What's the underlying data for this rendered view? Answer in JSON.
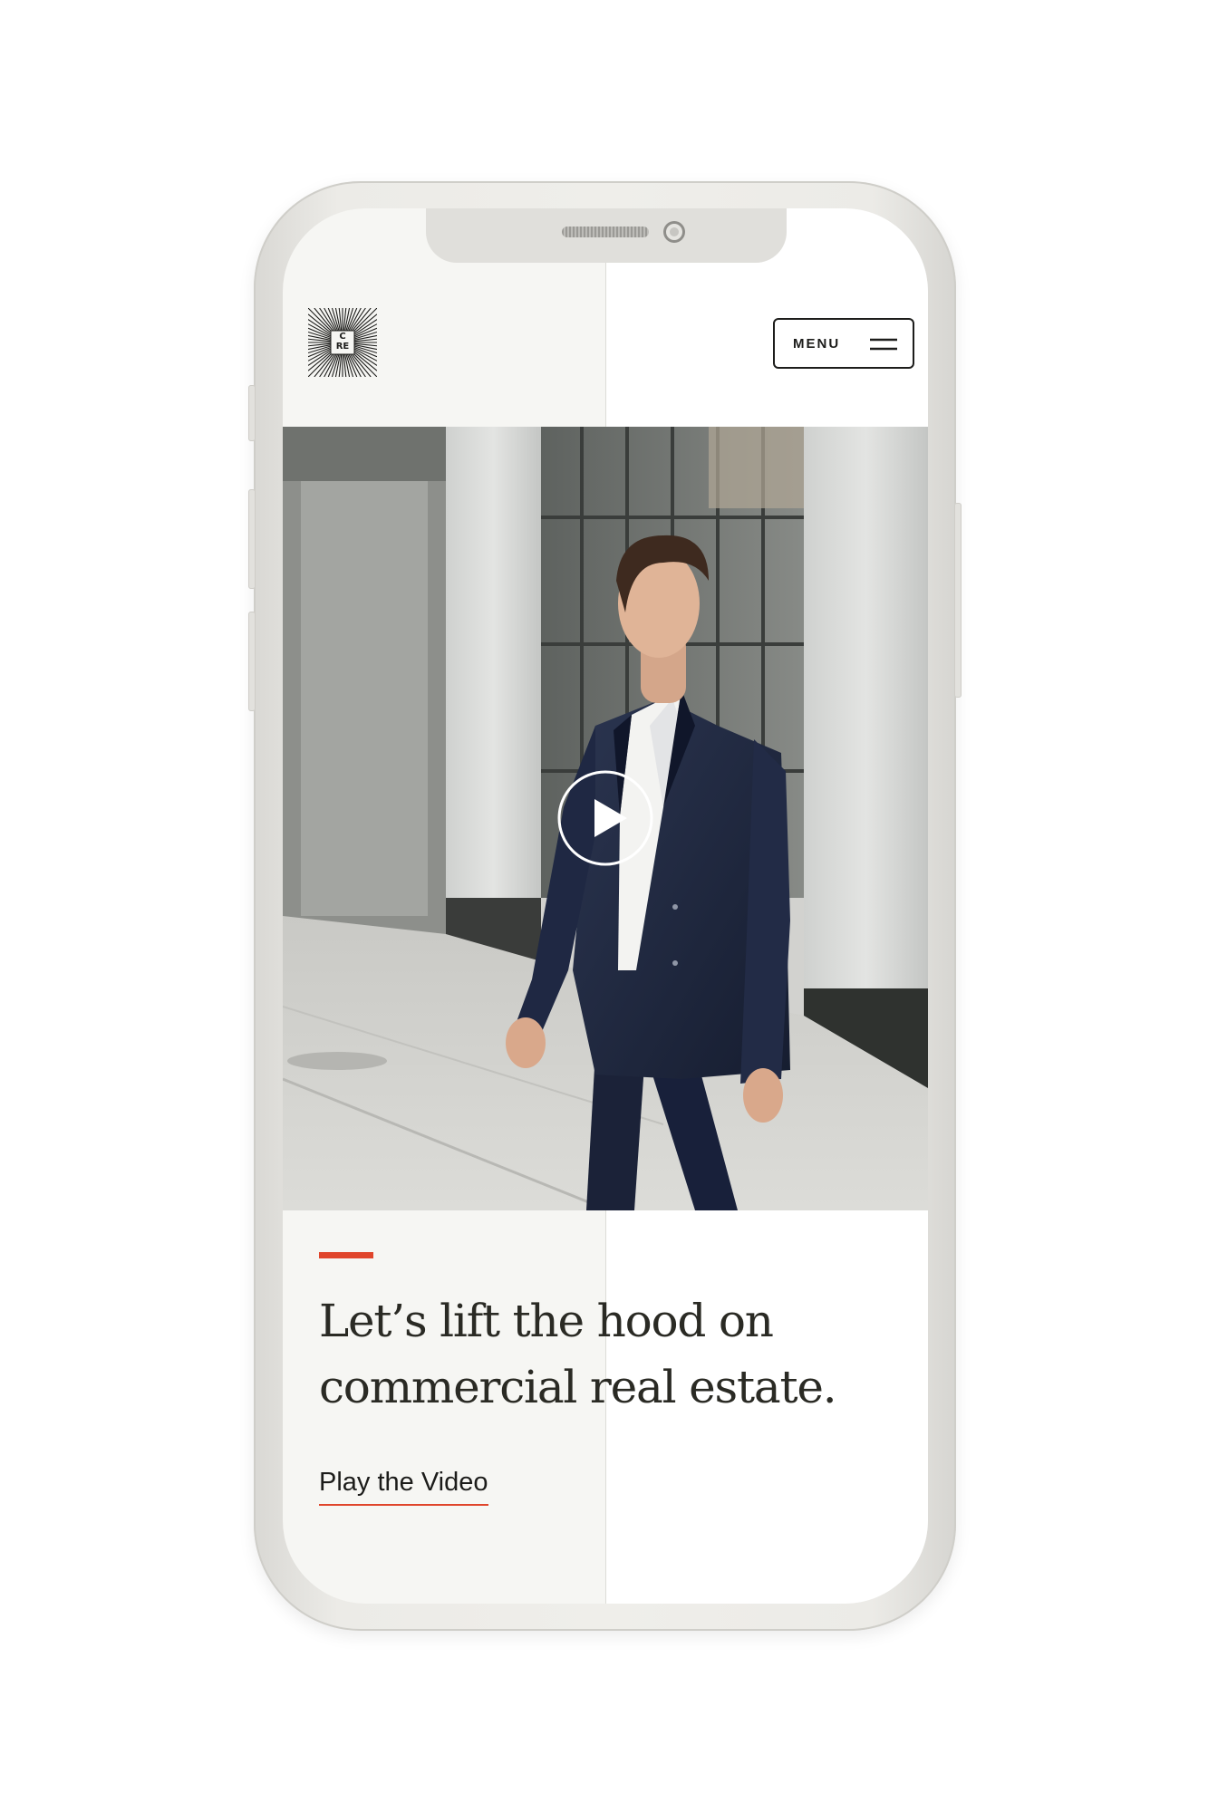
{
  "header": {
    "logo_letters": "C RE",
    "menu_label": "MENU"
  },
  "hero": {
    "image": "businessman-walking-photo",
    "play_icon": "play-icon"
  },
  "content": {
    "headline": "Let’s lift the hood on commercial real estate.",
    "cta_label": "Play the Video"
  },
  "colors": {
    "accent": "#e0452b",
    "text": "#2a2a24",
    "panel": "#f6f6f3",
    "phone_frame": "#ecebe7"
  }
}
